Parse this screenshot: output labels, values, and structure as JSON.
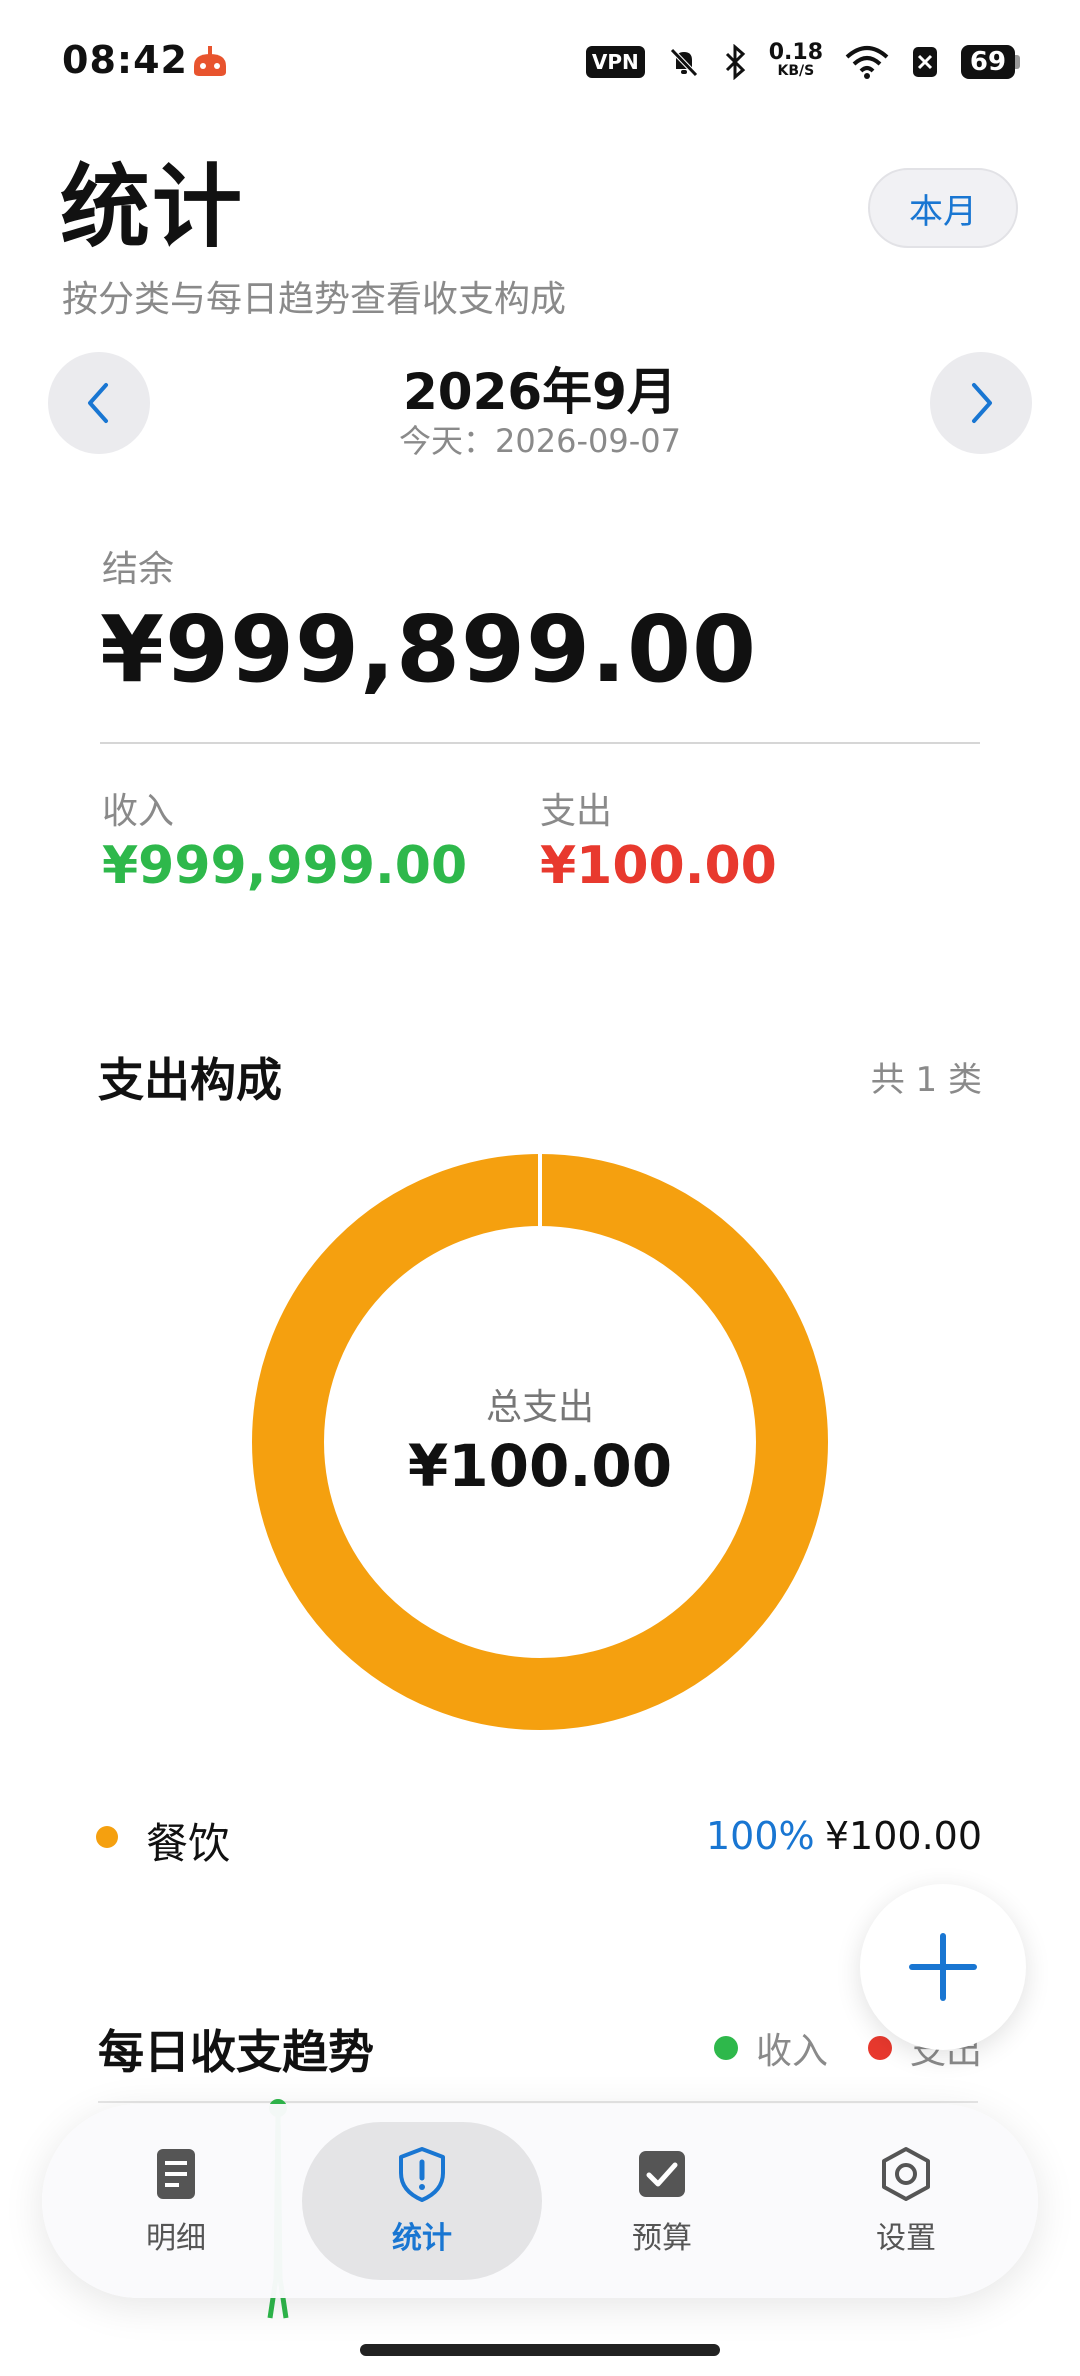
{
  "status_bar": {
    "time": "08:42",
    "vpn": "VPN",
    "net_speed_value": "0.18",
    "net_speed_unit": "KB/S",
    "battery": "69"
  },
  "header": {
    "title": "统计",
    "subtitle": "按分类与每日趋势查看收支构成",
    "this_month_button": "本月"
  },
  "month_nav": {
    "current": "2026年9月",
    "today": "今天：2026-09-07"
  },
  "summary": {
    "balance_label": "结余",
    "balance_value": "¥999,899.00",
    "income_label": "收入",
    "income_value": "¥999,999.00",
    "expense_label": "支出",
    "expense_value": "¥100.00",
    "colors": {
      "income": "#2eb84b",
      "expense": "#e8392e"
    }
  },
  "composition": {
    "title": "支出构成",
    "count": "共 1 类",
    "center_label": "总支出",
    "center_value": "¥100.00",
    "items": [
      {
        "name": "餐饮",
        "percent": "100%",
        "amount": "¥100.00",
        "color": "#f5a00f",
        "share": 1.0
      }
    ]
  },
  "trend": {
    "title": "每日收支趋势",
    "legend_income": "收入",
    "legend_expense": "支出"
  },
  "tabs": [
    {
      "label": "明细",
      "icon": "document-icon"
    },
    {
      "label": "统计",
      "icon": "shield-alert-icon",
      "active": true
    },
    {
      "label": "预算",
      "icon": "checkbox-icon"
    },
    {
      "label": "设置",
      "icon": "hexagon-gear-icon"
    }
  ],
  "accent_color": "#1976d2"
}
